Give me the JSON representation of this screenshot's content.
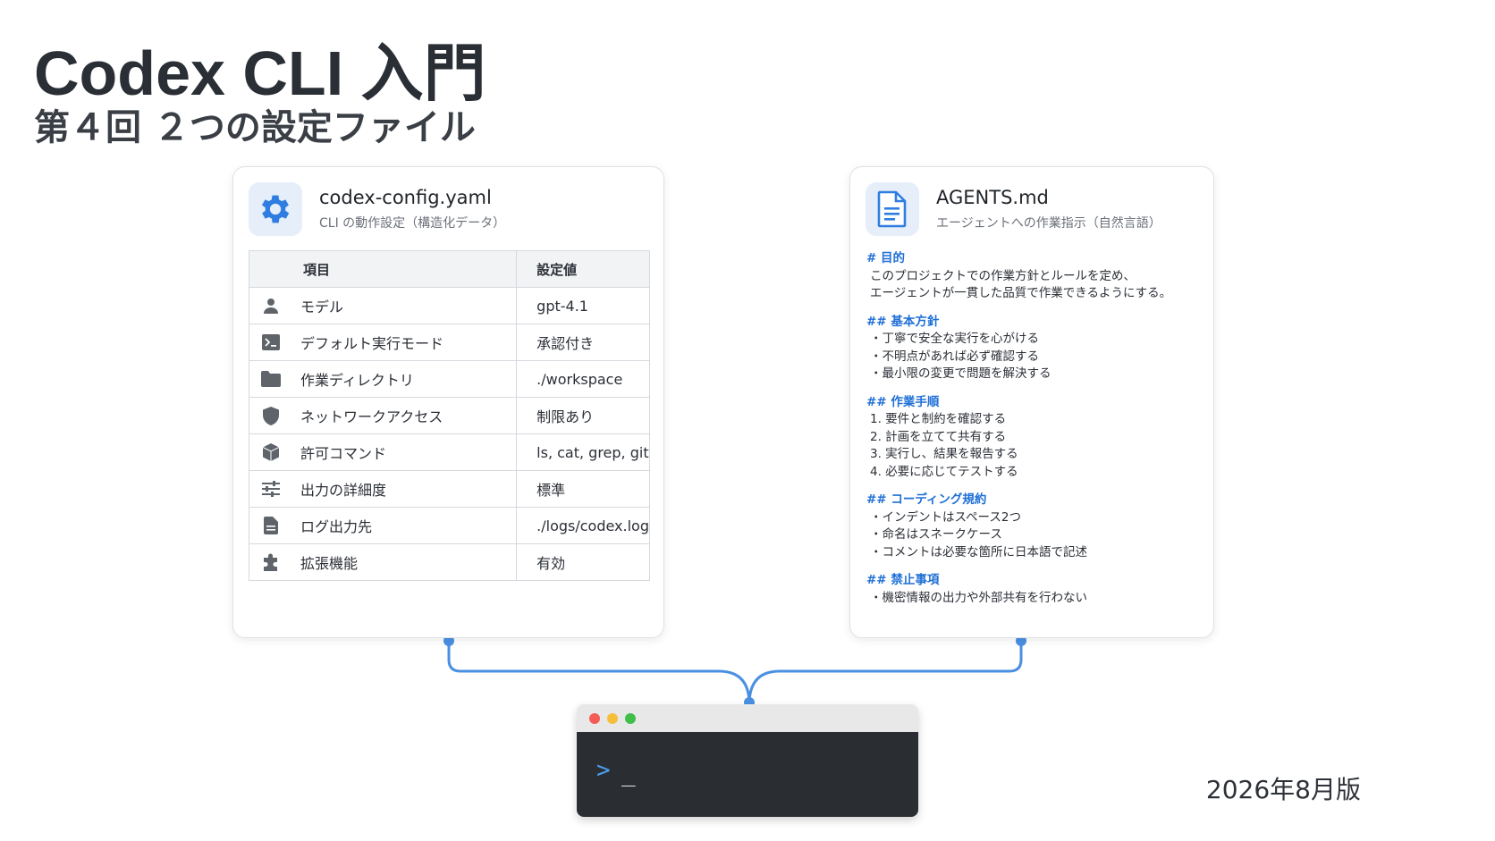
{
  "title": "Codex CLI 入門",
  "subtitle": "第４回 ２つの設定ファイル",
  "edition": "2026年8月版",
  "colors": {
    "accent": "#4a90e2",
    "heading_blue": "#1f6fd6",
    "terminal_bg": "#2a2d31"
  },
  "config_card": {
    "icon": "gear-icon",
    "file_name": "codex-config.yaml",
    "description": "CLI の動作設定（構造化データ）",
    "table": {
      "headers": [
        "項目",
        "設定値"
      ],
      "rows": [
        {
          "icon": "person-icon",
          "item": "モデル",
          "value": "gpt-4.1"
        },
        {
          "icon": "terminal-icon",
          "item": "デフォルト実行モード",
          "value": "承認付き"
        },
        {
          "icon": "folder-icon",
          "item": "作業ディレクトリ",
          "value": "./workspace"
        },
        {
          "icon": "shield-icon",
          "item": "ネットワークアクセス",
          "value": "制限あり"
        },
        {
          "icon": "box-icon",
          "item": "許可コマンド",
          "value": "ls, cat, grep, git"
        },
        {
          "icon": "sliders-icon",
          "item": "出力の詳細度",
          "value": "標準"
        },
        {
          "icon": "file-icon",
          "item": "ログ出力先",
          "value": "./logs/codex.log"
        },
        {
          "icon": "puzzle-icon",
          "item": "拡張機能",
          "value": "有効"
        }
      ]
    }
  },
  "agents_card": {
    "icon": "document-icon",
    "file_name": "AGENTS.md",
    "description": "エージェントへの作業指示（自然言語）",
    "sections": [
      {
        "heading": "# 目的",
        "lines": [
          "このプロジェクトでの作業方針とルールを定め、",
          "エージェントが一貫した品質で作業できるようにする。"
        ]
      },
      {
        "heading": "## 基本方針",
        "lines": [
          "・丁寧で安全な実行を心がける",
          "・不明点があれば必ず確認する",
          "・最小限の変更で問題を解決する"
        ]
      },
      {
        "heading": "## 作業手順",
        "lines": [
          "1. 要件と制約を確認する",
          "2. 計画を立てて共有する",
          "3. 実行し、結果を報告する",
          "4. 必要に応じてテストする"
        ]
      },
      {
        "heading": "## コーディング規約",
        "lines": [
          "・インデントはスペース2つ",
          "・命名はスネークケース",
          "・コメントは必要な箇所に日本語で記述"
        ]
      },
      {
        "heading": "## 禁止事項",
        "lines": [
          "・機密情報の出力や外部共有を行わない"
        ]
      }
    ]
  },
  "terminal": {
    "prompt": ">",
    "cursor": "_"
  }
}
